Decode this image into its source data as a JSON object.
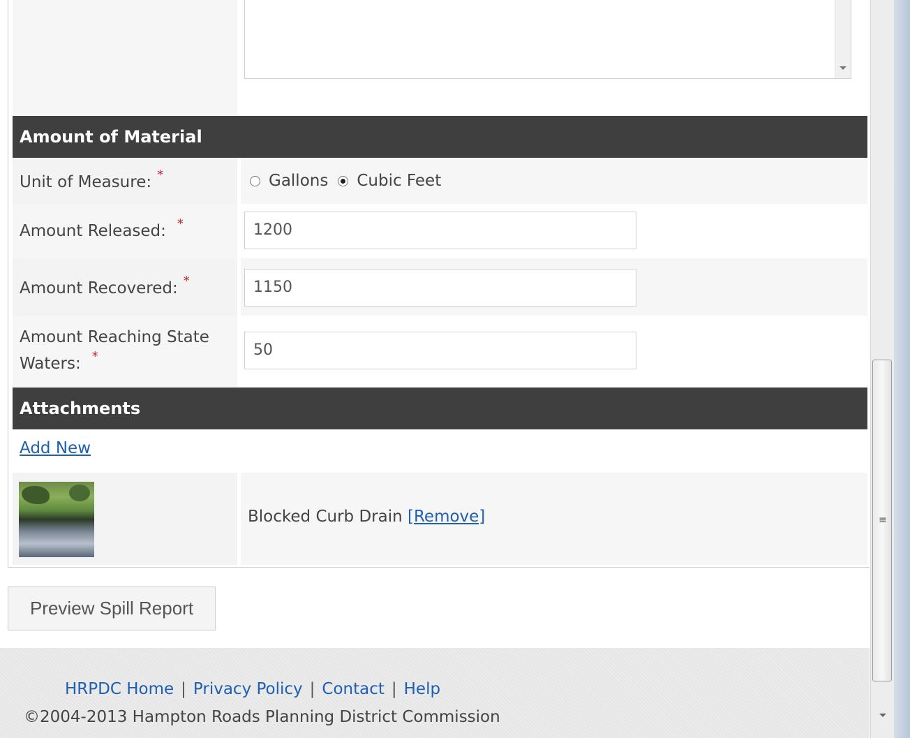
{
  "amount_section": {
    "header": "Amount of Material",
    "unit_label": "Unit of Measure:",
    "unit_options": [
      "Gallons",
      "Cubic Feet"
    ],
    "unit_selected": "Cubic Feet",
    "released_label": "Amount Released:",
    "released_value": "1200",
    "recovered_label": "Amount Recovered:",
    "recovered_value": "1150",
    "reaching_label_line1": "Amount Reaching State",
    "reaching_label_line2": "Waters:",
    "reaching_value": "50",
    "required_marker": "*"
  },
  "attachments_section": {
    "header": "Attachments",
    "add_new_label": "Add New",
    "items": [
      {
        "name": "Blocked Curb Drain",
        "remove_label": "[Remove]"
      }
    ]
  },
  "actions": {
    "preview_label": "Preview Spill Report"
  },
  "footer": {
    "links": [
      "HRPDC Home",
      "Privacy Policy",
      "Contact",
      "Help"
    ],
    "separator": "|",
    "copyright": "©2004-2013 Hampton Roads Planning District Commission"
  },
  "colors": {
    "section_header_bg": "#3f3f3f",
    "link": "#1f5fb0",
    "required": "#c0282d"
  }
}
